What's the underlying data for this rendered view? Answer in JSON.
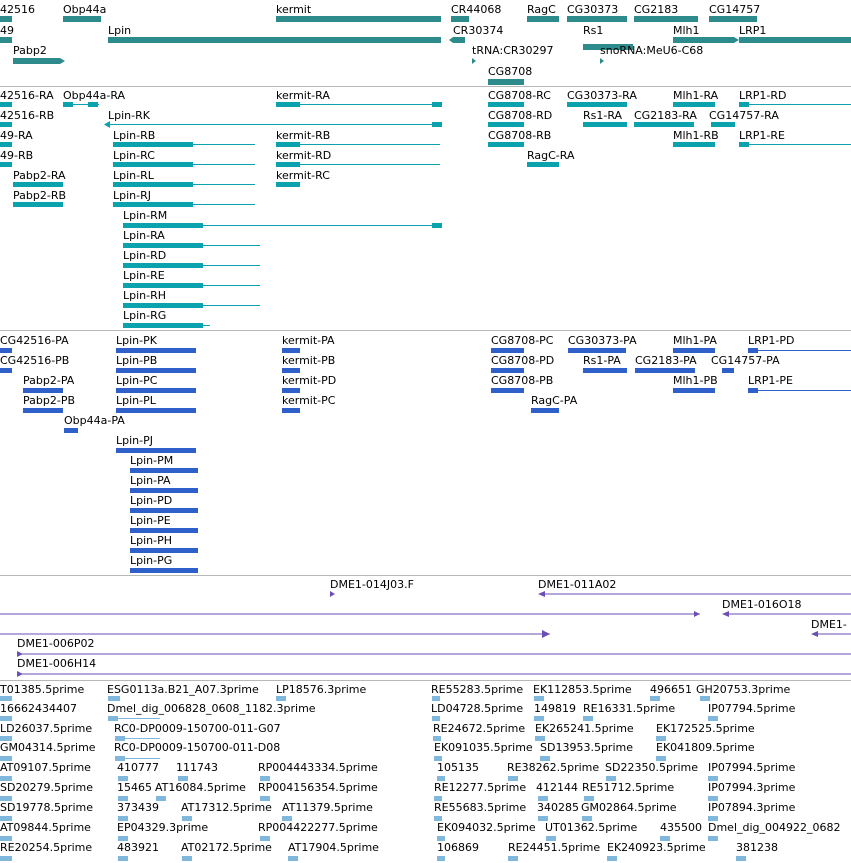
{
  "tracks": [
    {
      "id": "gene-track",
      "color": "#2e8b8b",
      "features": [
        {
          "label": "42516"
        },
        {
          "label": "Obp44a"
        },
        {
          "label": "kermit"
        },
        {
          "label": "CR44068"
        },
        {
          "label": "RagC"
        },
        {
          "label": "CG30373"
        },
        {
          "label": "CG2183"
        },
        {
          "label": "CG14757"
        },
        {
          "label": "49"
        },
        {
          "label": "Lpin"
        },
        {
          "label": "CR30374"
        },
        {
          "label": "Mlh1"
        },
        {
          "label": "LRP1"
        },
        {
          "label": "Rs1"
        },
        {
          "label": "Pabp2"
        },
        {
          "label": "tRNA:CR30297"
        },
        {
          "label": "snoRNA:MeU6-C68"
        },
        {
          "label": "CG8708"
        }
      ]
    },
    {
      "id": "transcript-track",
      "color": "#0aa3ad",
      "features": [
        {
          "label": "42516-RA"
        },
        {
          "label": "Obp44a-RA"
        },
        {
          "label": "kermit-RA"
        },
        {
          "label": "CG8708-RC"
        },
        {
          "label": "CG30373-RA"
        },
        {
          "label": "Mlh1-RA"
        },
        {
          "label": "LRP1-RD"
        },
        {
          "label": "42516-RB"
        },
        {
          "label": "Lpin-RK"
        },
        {
          "label": "CG8708-RD"
        },
        {
          "label": "Rs1-RA"
        },
        {
          "label": "CG2183-RA"
        },
        {
          "label": "CG14757-RA"
        },
        {
          "label": "49-RA"
        },
        {
          "label": "Lpin-RB"
        },
        {
          "label": "kermit-RB"
        },
        {
          "label": "CG8708-RB"
        },
        {
          "label": "Mlh1-RB"
        },
        {
          "label": "LRP1-RE"
        },
        {
          "label": "49-RB"
        },
        {
          "label": "Lpin-RC"
        },
        {
          "label": "kermit-RD"
        },
        {
          "label": "RagC-RA"
        },
        {
          "label": "Pabp2-RA"
        },
        {
          "label": "Lpin-RL"
        },
        {
          "label": "kermit-RC"
        },
        {
          "label": "Pabp2-RB"
        },
        {
          "label": "Lpin-RJ"
        },
        {
          "label": "Lpin-RM"
        },
        {
          "label": "Lpin-RA"
        },
        {
          "label": "Lpin-RD"
        },
        {
          "label": "Lpin-RE"
        },
        {
          "label": "Lpin-RH"
        },
        {
          "label": "Lpin-RG"
        }
      ]
    },
    {
      "id": "protein-track",
      "color": "#2f5fc8",
      "features": [
        {
          "label": "CG42516-PA"
        },
        {
          "label": "Lpin-PK"
        },
        {
          "label": "kermit-PA"
        },
        {
          "label": "CG8708-PC"
        },
        {
          "label": "CG30373-PA"
        },
        {
          "label": "Mlh1-PA"
        },
        {
          "label": "LRP1-PD"
        },
        {
          "label": "CG42516-PB"
        },
        {
          "label": "Lpin-PB"
        },
        {
          "label": "kermit-PB"
        },
        {
          "label": "CG8708-PD"
        },
        {
          "label": "Rs1-PA"
        },
        {
          "label": "CG2183-PA"
        },
        {
          "label": "CG14757-PA"
        },
        {
          "label": "Pabp2-PA"
        },
        {
          "label": "Lpin-PC"
        },
        {
          "label": "kermit-PD"
        },
        {
          "label": "CG8708-PB"
        },
        {
          "label": "Mlh1-PB"
        },
        {
          "label": "LRP1-PE"
        },
        {
          "label": "Pabp2-PB"
        },
        {
          "label": "Lpin-PL"
        },
        {
          "label": "kermit-PC"
        },
        {
          "label": "RagC-PA"
        },
        {
          "label": "Obp44a-PA"
        },
        {
          "label": "Lpin-PJ"
        },
        {
          "label": "Lpin-PM"
        },
        {
          "label": "Lpin-PA"
        },
        {
          "label": "Lpin-PD"
        },
        {
          "label": "Lpin-PE"
        },
        {
          "label": "Lpin-PH"
        },
        {
          "label": "Lpin-PG"
        }
      ]
    },
    {
      "id": "clone-track",
      "color": "#6b4fb3",
      "features": [
        {
          "label": "DME1-014J03.F"
        },
        {
          "label": "DME1-011A02"
        },
        {
          "label": "DME1-016O18"
        },
        {
          "label": "DME1-"
        },
        {
          "label": "DME1-006P02"
        },
        {
          "label": "DME1-006H14"
        }
      ]
    },
    {
      "id": "est-track",
      "color": "#7fb8dc",
      "features": [
        {
          "label": "T01385.5prime"
        },
        {
          "label": "ESG0113a.B21_A07.3prime"
        },
        {
          "label": "LP18576.3prime"
        },
        {
          "label": "RE55283.5prime"
        },
        {
          "label": "EK112853.5prime"
        },
        {
          "label": "496651"
        },
        {
          "label": "GH20753.3prime"
        },
        {
          "label": "16662434407"
        },
        {
          "label": "Dmel_dig_006828_0608_1182.3prime"
        },
        {
          "label": "LD04728.5prime"
        },
        {
          "label": "149819"
        },
        {
          "label": "RE16331.5prime"
        },
        {
          "label": "IP07794.5prime"
        },
        {
          "label": "LD26037.5prime"
        },
        {
          "label": "RC0-DP0009-150700-011-G07"
        },
        {
          "label": "RE24672.5prime"
        },
        {
          "label": "EK265241.5prime"
        },
        {
          "label": "EK172525.5prime"
        },
        {
          "label": "GM04314.5prime"
        },
        {
          "label": "RC0-DP0009-150700-011-D08"
        },
        {
          "label": "EK091035.5prime"
        },
        {
          "label": "SD13953.5prime"
        },
        {
          "label": "EK041809.5prime"
        },
        {
          "label": "AT09107.5prime"
        },
        {
          "label": "410777"
        },
        {
          "label": "111743"
        },
        {
          "label": "RP004443334.5prime"
        },
        {
          "label": "105135"
        },
        {
          "label": "RE38262.5prime"
        },
        {
          "label": "SD22350.5prime"
        },
        {
          "label": "IP07994.5prime"
        },
        {
          "label": "SD20279.5prime"
        },
        {
          "label": "15465"
        },
        {
          "label": "AT16084.5prime"
        },
        {
          "label": "RP004156354.5prime"
        },
        {
          "label": "RE12277.5prime"
        },
        {
          "label": "412144"
        },
        {
          "label": "RE51712.5prime"
        },
        {
          "label": "IP07994.3prime"
        },
        {
          "label": "SD19778.5prime"
        },
        {
          "label": "373439"
        },
        {
          "label": "AT17312.5prime"
        },
        {
          "label": "AT11379.5prime"
        },
        {
          "label": "RE55683.5prime"
        },
        {
          "label": "340285"
        },
        {
          "label": "GM02864.5prime"
        },
        {
          "label": "IP07894.3prime"
        },
        {
          "label": "AT09844.5prime"
        },
        {
          "label": "EP04329.3prime"
        },
        {
          "label": "RP004422277.5prime"
        },
        {
          "label": "EK094032.5prime"
        },
        {
          "label": "UT01362.5prime"
        },
        {
          "label": "435500"
        },
        {
          "label": "Dmel_dig_004922_0682"
        },
        {
          "label": "RE20254.5prime"
        },
        {
          "label": "483921"
        },
        {
          "label": "AT02172.5prime"
        },
        {
          "label": "AT17904.5prime"
        },
        {
          "label": "106869"
        },
        {
          "label": "RE24451.5prime"
        },
        {
          "label": "EK240923.5prime"
        },
        {
          "label": "381238"
        }
      ]
    }
  ]
}
